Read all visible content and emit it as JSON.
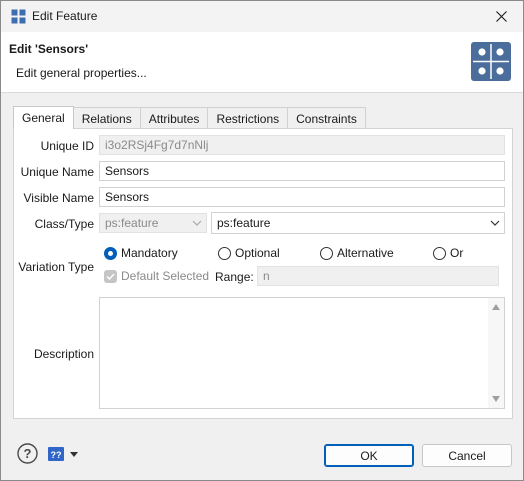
{
  "window": {
    "title": "Edit Feature",
    "close_icon": "close-icon",
    "app_icon": "app-icon"
  },
  "header": {
    "title": "Edit 'Sensors'",
    "subtitle": "Edit general properties...",
    "icon": "feature-grid-icon",
    "accent": "#4a6d9c"
  },
  "tabs": [
    {
      "label": "General",
      "active": true
    },
    {
      "label": "Relations"
    },
    {
      "label": "Attributes"
    },
    {
      "label": "Restrictions"
    },
    {
      "label": "Constraints"
    }
  ],
  "form": {
    "unique_id": {
      "label": "Unique ID",
      "value": "i3o2RSj4Fg7d7nNlj"
    },
    "unique_name": {
      "label": "Unique Name",
      "value": "Sensors"
    },
    "visible_name": {
      "label": "Visible Name",
      "value": "Sensors"
    },
    "class_type": {
      "label": "Class/Type",
      "class_value": "ps:feature",
      "type_value": "ps:feature"
    },
    "variation_type": {
      "label": "Variation Type",
      "options": [
        {
          "label": "Mandatory",
          "selected": true
        },
        {
          "label": "Optional",
          "selected": false
        },
        {
          "label": "Alternative",
          "selected": false
        },
        {
          "label": "Or",
          "selected": false
        }
      ],
      "default_selected_label": "Default Selected",
      "range_label": "Range:",
      "range_value": "n"
    },
    "description": {
      "label": "Description",
      "value": ""
    }
  },
  "footer": {
    "ok_label": "OK",
    "cancel_label": "Cancel",
    "help_icon": "help-icon",
    "help_menu_icon": "help-menu-icon",
    "help_menu_glyph": "??",
    "accent": "#005fb8"
  }
}
